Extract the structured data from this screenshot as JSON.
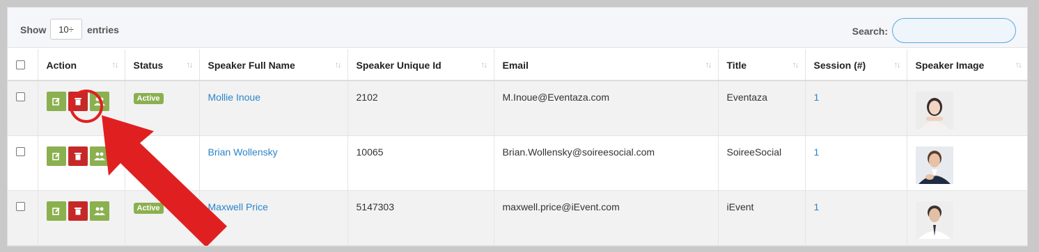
{
  "toolbar": {
    "show_label": "Show",
    "page_size": "10",
    "page_size_caret": "÷",
    "entries_label": "entries",
    "search_label": "Search:",
    "search_value": ""
  },
  "columns": {
    "action": "Action",
    "status": "Status",
    "name": "Speaker Full Name",
    "uid": "Speaker Unique Id",
    "email": "Email",
    "title": "Title",
    "session": "Session (#)",
    "image": "Speaker Image"
  },
  "sort_icon": "↑↓",
  "rows": [
    {
      "status": "Active",
      "name": "Mollie Inoue",
      "uid": "2102",
      "email": "M.Inoue@Eventaza.com",
      "title": "Eventaza",
      "session": "1"
    },
    {
      "status": "",
      "name": "Brian Wollensky",
      "uid": "10065",
      "email": "Brian.Wollensky@soireesocial.com",
      "title": "SoireeSocial",
      "session": "1"
    },
    {
      "status": "Active",
      "name": "Maxwell Price",
      "uid": "5147303",
      "email": "maxwell.price@iEvent.com",
      "title": "iEvent",
      "session": "1"
    }
  ],
  "icons": {
    "edit": "edit-icon",
    "delete": "trash-icon",
    "assign": "users-icon"
  },
  "colors": {
    "green": "#8bb04f",
    "red": "#c62828",
    "link": "#2a84c9",
    "annotation": "#e02020"
  }
}
